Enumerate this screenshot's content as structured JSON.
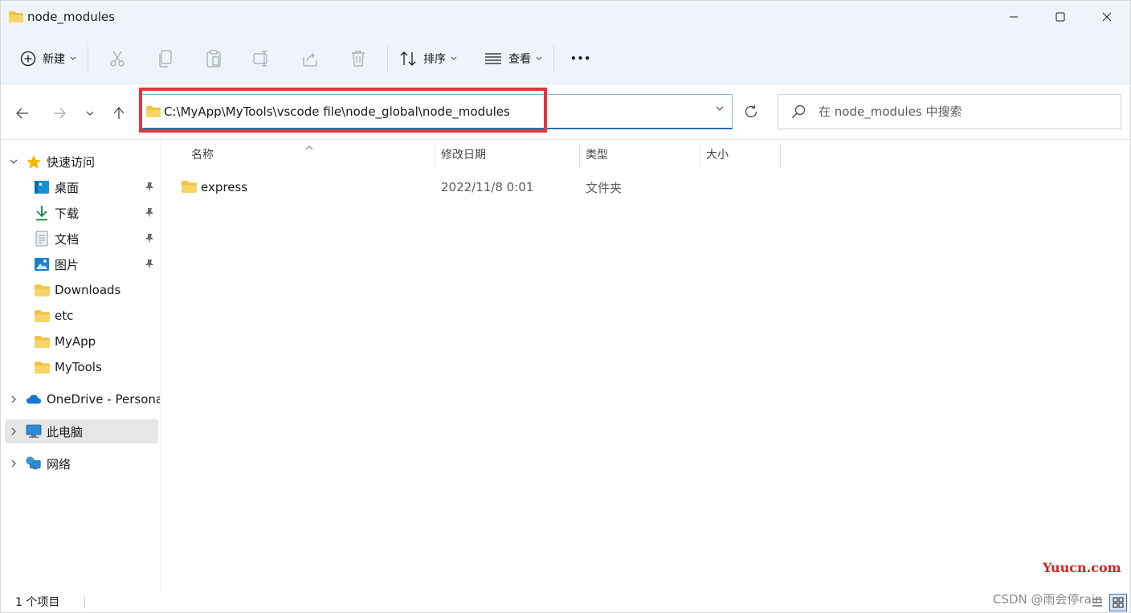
{
  "window": {
    "title": "node_modules"
  },
  "toolbar": {
    "new_label": "新建",
    "sort_label": "排序",
    "view_label": "查看",
    "more_label": "•••"
  },
  "navbar": {
    "address": "C:\\MyApp\\MyTools\\vscode file\\node_global\\node_modules",
    "search_placeholder": "在 node_modules 中搜索"
  },
  "sidebar": {
    "quick_access": "快速访问",
    "items": [
      {
        "label": "桌面",
        "icon": "desktop-icon",
        "pinned": true
      },
      {
        "label": "下载",
        "icon": "download-icon",
        "pinned": true
      },
      {
        "label": "文档",
        "icon": "document-icon",
        "pinned": true
      },
      {
        "label": "图片",
        "icon": "picture-icon",
        "pinned": true
      },
      {
        "label": "Downloads",
        "icon": "folder-icon",
        "pinned": false
      },
      {
        "label": "etc",
        "icon": "folder-icon",
        "pinned": false
      },
      {
        "label": "MyApp",
        "icon": "folder-icon",
        "pinned": false
      },
      {
        "label": "MyTools",
        "icon": "folder-icon",
        "pinned": false
      }
    ],
    "onedrive": "OneDrive - Persona",
    "this_pc": "此电脑",
    "network": "网络"
  },
  "columns": {
    "name": "名称",
    "modified": "修改日期",
    "type": "类型",
    "size": "大小"
  },
  "files": [
    {
      "name": "express",
      "modified": "2022/11/8 0:01",
      "type": "文件夹",
      "size": ""
    }
  ],
  "status": {
    "count": "1 个项目"
  },
  "watermarks": {
    "yuucn": "Yuucn.com",
    "csdn": "CSDN @雨会停rain"
  },
  "colors": {
    "chrome_bg": "#eef4fa",
    "folder_yellow": "#f3c242",
    "highlight_red": "#e8343c",
    "accent_blue": "#2f6fb3"
  }
}
